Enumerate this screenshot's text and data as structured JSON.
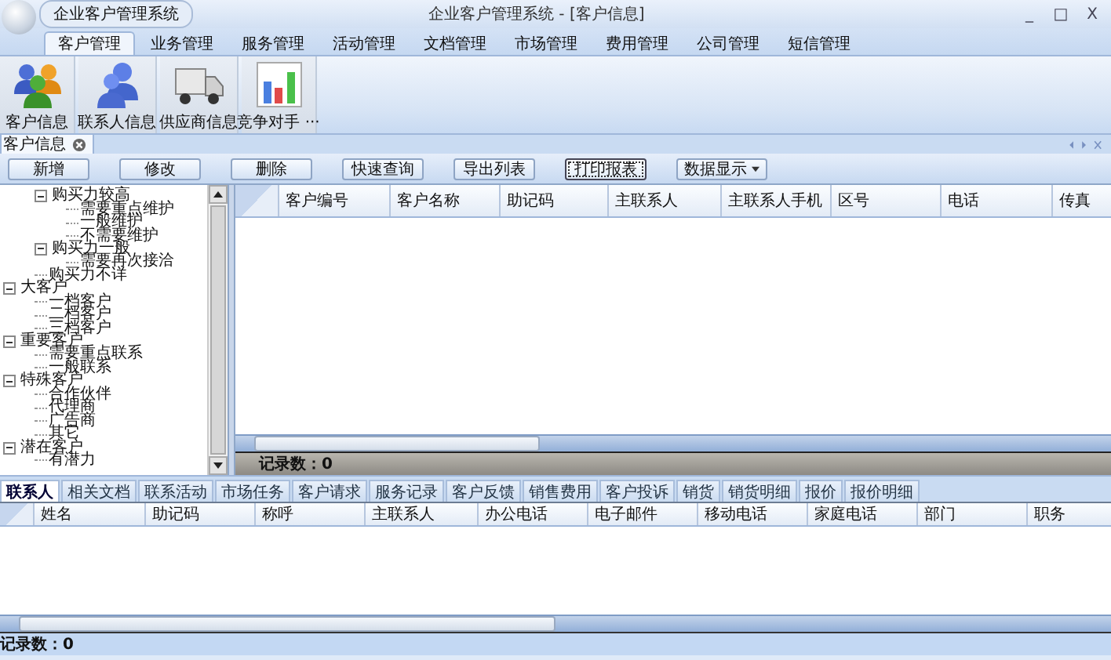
{
  "window": {
    "app_button": "企业客户管理系统",
    "title": "企业客户管理系统 - [客户信息]",
    "controls": [
      "_",
      "□",
      "X"
    ]
  },
  "ribbon": {
    "tabs": [
      {
        "label": "客户管理",
        "selected": true
      },
      {
        "label": "业务管理",
        "selected": false
      },
      {
        "label": "服务管理",
        "selected": false
      },
      {
        "label": "活动管理",
        "selected": false
      },
      {
        "label": "文档管理",
        "selected": false
      },
      {
        "label": "市场管理",
        "selected": false
      },
      {
        "label": "费用管理",
        "selected": false
      },
      {
        "label": "公司管理",
        "selected": false
      },
      {
        "label": "短信管理",
        "selected": false
      }
    ],
    "items": [
      {
        "label": "客户信息"
      },
      {
        "label": "联系人信息"
      },
      {
        "label": "供应商信息"
      },
      {
        "label": "竞争对手 ···"
      }
    ]
  },
  "document_tab": {
    "label": "客户信息"
  },
  "toolbar": [
    {
      "label": "新增",
      "kind": "button",
      "focused": false
    },
    {
      "label": "修改",
      "kind": "button",
      "focused": false
    },
    {
      "label": "删除",
      "kind": "button",
      "focused": false
    },
    {
      "label": "快速查询",
      "kind": "button",
      "focused": false
    },
    {
      "label": "导出列表",
      "kind": "button",
      "focused": false
    },
    {
      "label": "打印报表",
      "kind": "button",
      "focused": true
    },
    {
      "label": "数据显示",
      "kind": "dropdown",
      "focused": false
    }
  ],
  "tree": {
    "items": [
      {
        "children": [
          {
            "label": "购买力较高",
            "expanded": true,
            "children": [
              {
                "label": "需要重点维护"
              },
              {
                "label": "一般维护"
              },
              {
                "label": "不需要维护"
              }
            ]
          },
          {
            "label": "购买力一般",
            "expanded": true,
            "children": [
              {
                "label": "需要再次接洽"
              }
            ]
          },
          {
            "label": "购买力不详"
          }
        ]
      },
      {
        "label": "大客户",
        "expanded": true,
        "children": [
          {
            "label": "一档客户"
          },
          {
            "label": "二档客户"
          },
          {
            "label": "三档客户"
          }
        ]
      },
      {
        "label": "重要客户",
        "expanded": true,
        "children": [
          {
            "label": "需要重点联系"
          },
          {
            "label": "一般联系"
          }
        ]
      },
      {
        "label": "特殊客户",
        "expanded": true,
        "children": [
          {
            "label": "合作伙伴"
          },
          {
            "label": "代理商"
          },
          {
            "label": "广告商"
          },
          {
            "label": "其它"
          }
        ]
      },
      {
        "label": "潜在客户",
        "expanded": true,
        "children": [
          {
            "label": "有潜力"
          }
        ]
      }
    ]
  },
  "table": {
    "columns": [
      "客户编号",
      "客户名称",
      "助记码",
      "主联系人",
      "主联系人手机",
      "区号",
      "电话",
      "传真"
    ],
    "status": "记录数：0"
  },
  "detail_tabs": [
    {
      "label": "联系人",
      "selected": true
    },
    {
      "label": "相关文档",
      "selected": false
    },
    {
      "label": "联系活动",
      "selected": false
    },
    {
      "label": "市场任务",
      "selected": false
    },
    {
      "label": "客户请求",
      "selected": false
    },
    {
      "label": "服务记录",
      "selected": false
    },
    {
      "label": "客户反馈",
      "selected": false
    },
    {
      "label": "销售费用",
      "selected": false
    },
    {
      "label": "客户投诉",
      "selected": false
    },
    {
      "label": "销货",
      "selected": false
    },
    {
      "label": "销货明细",
      "selected": false
    },
    {
      "label": "报价",
      "selected": false
    },
    {
      "label": "报价明细",
      "selected": false
    }
  ],
  "detail_table": {
    "columns": [
      "姓名",
      "助记码",
      "称呼",
      "主联系人",
      "办公电话",
      "电子邮件",
      "移动电话",
      "家庭电话",
      "部门",
      "职务"
    ],
    "status": "记录数：0"
  }
}
